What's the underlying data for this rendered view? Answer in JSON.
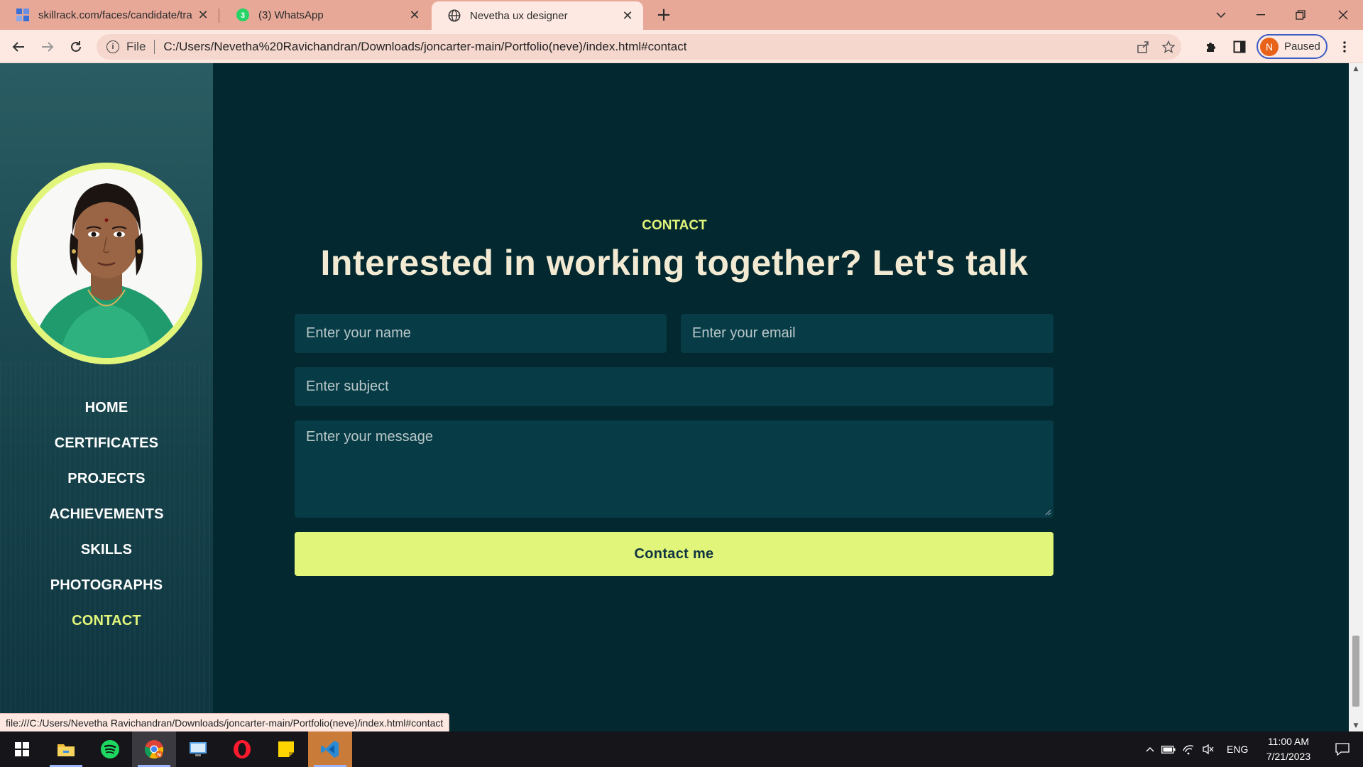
{
  "browser": {
    "tabs": [
      {
        "title": "skillrack.com/faces/candidate/tra",
        "icon": "skillrack-favicon"
      },
      {
        "title": "(3) WhatsApp",
        "icon": "whatsapp-favicon"
      },
      {
        "title": "Nevetha ux designer",
        "icon": "globe-favicon"
      }
    ],
    "file_label": "File",
    "url": "C:/Users/Nevetha%20Ravichandran/Downloads/joncarter-main/Portfolio(neve)/index.html#contact",
    "profile": {
      "initial": "N",
      "label": "Paused"
    },
    "status_url": "file:///C:/Users/Nevetha Ravichandran/Downloads/joncarter-main/Portfolio(neve)/index.html#contact"
  },
  "sidebar": {
    "nav": [
      {
        "label": "HOME"
      },
      {
        "label": "CERTIFICATES"
      },
      {
        "label": "PROJECTS"
      },
      {
        "label": "ACHIEVEMENTS"
      },
      {
        "label": "SKILLS"
      },
      {
        "label": "PHOTOGRAPHS"
      },
      {
        "label": "CONTACT",
        "active": true
      }
    ]
  },
  "contact": {
    "section_label": "CONTACT",
    "headline": "Interested in working together? Let's talk",
    "name_placeholder": "Enter your name",
    "email_placeholder": "Enter your email",
    "subject_placeholder": "Enter subject",
    "message_placeholder": "Enter your message",
    "submit_label": "Contact me"
  },
  "taskbar": {
    "apps": [
      "windows-start",
      "file-explorer",
      "spotify",
      "chrome",
      "remote-desktop",
      "opera",
      "sticky-notes",
      "vscode"
    ],
    "language": "ENG",
    "time": "11:00 AM",
    "date": "7/21/2023"
  },
  "colors": {
    "accent": "#e2f57b",
    "page_bg": "#03282f",
    "field_bg": "#073b46",
    "headline": "#f2ead2",
    "tabbar": "#e7a898"
  }
}
